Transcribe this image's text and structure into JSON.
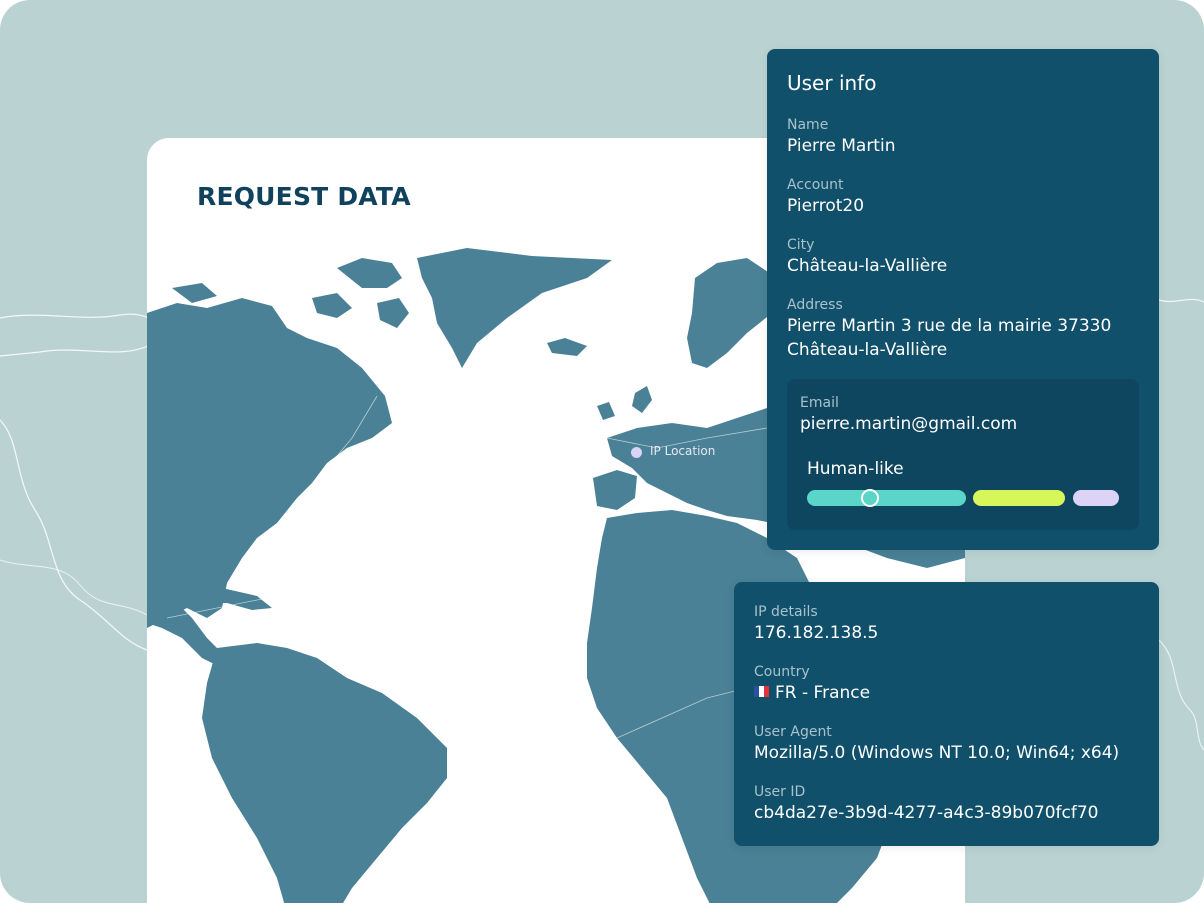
{
  "card": {
    "title": "REQUEST DATA",
    "ip_marker_label": "IP Location"
  },
  "user_info": {
    "title": "User info",
    "name_label": "Name",
    "name_value": "Pierre Martin",
    "account_label": "Account",
    "account_value": "Pierrot20",
    "city_label": "City",
    "city_value": "Château-la-Vallière",
    "address_label": "Address",
    "address_line1": "Pierre Martin 3 rue de la mairie 37330",
    "address_line2": "Château-la-Vallière",
    "email_label": "Email",
    "email_value": "pierre.martin@gmail.com",
    "human_label": "Human-like"
  },
  "ip_details": {
    "ip_label": "IP details",
    "ip_value": "176.182.138.5",
    "country_label": "Country",
    "country_value": "FR - France",
    "country_flag_icon": "france-flag-icon",
    "agent_label": "User Agent",
    "agent_value": "Mozilla/5.0 (Windows NT 10.0; Win64; x64)",
    "userid_label": "User ID",
    "userid_value": "cb4da27e-3b9d-4277-a4c3-89b070fcf70"
  },
  "colors": {
    "background": "#bad3d2",
    "card": "#ffffff",
    "map_land": "#4a8196",
    "panel": "#10506b",
    "title_text": "#10425e",
    "segment_teal": "#5ad5c8",
    "segment_lime": "#d6f65a",
    "segment_lavender": "#dcd3f7"
  }
}
